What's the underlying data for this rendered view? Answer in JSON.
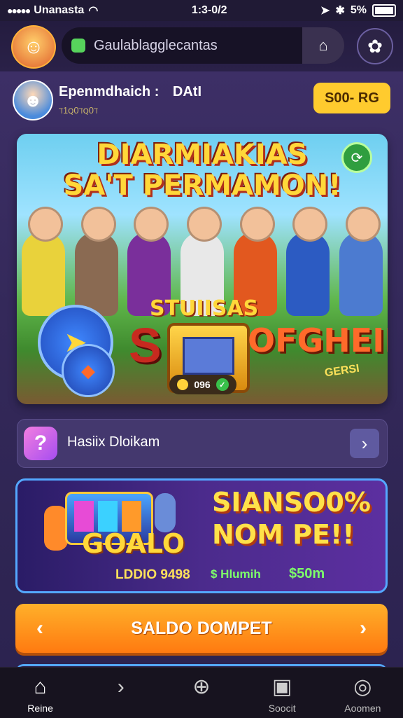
{
  "status_bar": {
    "carrier": "Unanasta",
    "time": "1:3-0/2",
    "battery": "5%"
  },
  "header": {
    "search_value": "Gaulablagglecantas"
  },
  "profile": {
    "name": "Epenmdhaich :",
    "tag": "DAtI",
    "sub": "ℸ1ꞯ0ℸꞯ0ℸ",
    "coins": "S00- RG"
  },
  "banner": {
    "title_line1": "DIARMIAKIAS",
    "title_line2": "SA'T PERMAMON!",
    "sub1": "STUIISAS",
    "sub2": "OFGHEII",
    "sub3": "GERSI",
    "chest_value": "096"
  },
  "help_row": {
    "label": "Hasiix Dloikam"
  },
  "promo": {
    "logo": "GOALO",
    "headline": "SIANSO0% NOM PE!!",
    "code": "LDDIO 9498",
    "mini": "$ Hlumih",
    "amount": "$50m"
  },
  "wallet_button": {
    "label": "SALDO DOMPET"
  },
  "bottom_nav": [
    {
      "label": "Reine",
      "icon": "home-icon"
    },
    {
      "label": "",
      "icon": "chevron-right-icon"
    },
    {
      "label": "",
      "icon": "plus-icon"
    },
    {
      "label": "Soocit",
      "icon": "book-icon"
    },
    {
      "label": "Aoomen",
      "icon": "target-icon"
    }
  ],
  "colors": {
    "accent": "#ffcb2e",
    "primary_bg": "#3d2f66",
    "wallet": "#ff8a1a",
    "promo_border": "#54a8ff"
  }
}
